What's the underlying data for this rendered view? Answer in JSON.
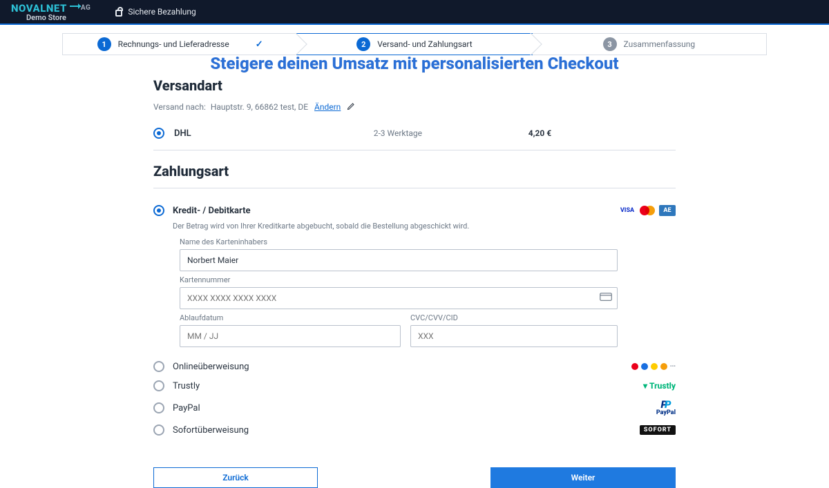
{
  "brand": {
    "name": "NOVALNET",
    "suffix": "AG",
    "sub": "Demo Store"
  },
  "secure_label": "Sichere Bezahlung",
  "steps": {
    "s1": {
      "num": "1",
      "label": "Rechnungs- und Lieferadresse",
      "done": "✓"
    },
    "s2": {
      "num": "2",
      "label": "Versand- und Zahlungsart"
    },
    "s3": {
      "num": "3",
      "label": "Zusammenfassung"
    }
  },
  "headline": "Steigere deinen Umsatz mit personalisierten Checkout",
  "shipping": {
    "title": "Versandart",
    "to_label": "Versand nach:",
    "address": "Hauptstr. 9, 66862 test, DE",
    "change": "Ändern",
    "option": {
      "name": "DHL",
      "eta": "2-3 Werktage",
      "price": "4,20 €"
    }
  },
  "payment": {
    "title": "Zahlungsart",
    "selected": {
      "name": "Kredit- / Debitkarte",
      "note": "Der Betrag wird von Ihrer Kreditkarte abgebucht, sobald die Bestellung abgeschickt wird.",
      "brands": {
        "visa": "VISA",
        "amex": "AE"
      }
    },
    "form": {
      "holder_label": "Name des Karteninhabers",
      "holder_value": "Norbert Maier",
      "number_label": "Kartennummer",
      "number_placeholder": "XXXX XXXX XXXX XXXX",
      "expiry_label": "Ablaufdatum",
      "expiry_placeholder": "MM / JJ",
      "cvc_label": "CVC/CVV/CID",
      "cvc_placeholder": "XXX"
    },
    "others": {
      "online": "Onlineüberweisung",
      "trustly": "Trustly",
      "trustly_brand": "Trustly",
      "paypal": "PayPal",
      "paypal_brand": "PayPal",
      "sofort": "Sofortüberweisung",
      "sofort_brand": "SOFORT"
    }
  },
  "actions": {
    "back": "Zurück",
    "next": "Weiter"
  }
}
